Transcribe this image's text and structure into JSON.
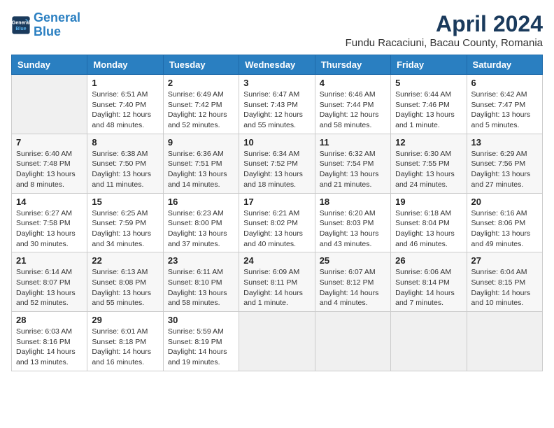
{
  "header": {
    "logo_line1": "General",
    "logo_line2": "Blue",
    "month_title": "April 2024",
    "location": "Fundu Racaciuni, Bacau County, Romania"
  },
  "weekdays": [
    "Sunday",
    "Monday",
    "Tuesday",
    "Wednesday",
    "Thursday",
    "Friday",
    "Saturday"
  ],
  "weeks": [
    [
      {
        "day": "",
        "info": ""
      },
      {
        "day": "1",
        "info": "Sunrise: 6:51 AM\nSunset: 7:40 PM\nDaylight: 12 hours\nand 48 minutes."
      },
      {
        "day": "2",
        "info": "Sunrise: 6:49 AM\nSunset: 7:42 PM\nDaylight: 12 hours\nand 52 minutes."
      },
      {
        "day": "3",
        "info": "Sunrise: 6:47 AM\nSunset: 7:43 PM\nDaylight: 12 hours\nand 55 minutes."
      },
      {
        "day": "4",
        "info": "Sunrise: 6:46 AM\nSunset: 7:44 PM\nDaylight: 12 hours\nand 58 minutes."
      },
      {
        "day": "5",
        "info": "Sunrise: 6:44 AM\nSunset: 7:46 PM\nDaylight: 13 hours\nand 1 minute."
      },
      {
        "day": "6",
        "info": "Sunrise: 6:42 AM\nSunset: 7:47 PM\nDaylight: 13 hours\nand 5 minutes."
      }
    ],
    [
      {
        "day": "7",
        "info": "Sunrise: 6:40 AM\nSunset: 7:48 PM\nDaylight: 13 hours\nand 8 minutes."
      },
      {
        "day": "8",
        "info": "Sunrise: 6:38 AM\nSunset: 7:50 PM\nDaylight: 13 hours\nand 11 minutes."
      },
      {
        "day": "9",
        "info": "Sunrise: 6:36 AM\nSunset: 7:51 PM\nDaylight: 13 hours\nand 14 minutes."
      },
      {
        "day": "10",
        "info": "Sunrise: 6:34 AM\nSunset: 7:52 PM\nDaylight: 13 hours\nand 18 minutes."
      },
      {
        "day": "11",
        "info": "Sunrise: 6:32 AM\nSunset: 7:54 PM\nDaylight: 13 hours\nand 21 minutes."
      },
      {
        "day": "12",
        "info": "Sunrise: 6:30 AM\nSunset: 7:55 PM\nDaylight: 13 hours\nand 24 minutes."
      },
      {
        "day": "13",
        "info": "Sunrise: 6:29 AM\nSunset: 7:56 PM\nDaylight: 13 hours\nand 27 minutes."
      }
    ],
    [
      {
        "day": "14",
        "info": "Sunrise: 6:27 AM\nSunset: 7:58 PM\nDaylight: 13 hours\nand 30 minutes."
      },
      {
        "day": "15",
        "info": "Sunrise: 6:25 AM\nSunset: 7:59 PM\nDaylight: 13 hours\nand 34 minutes."
      },
      {
        "day": "16",
        "info": "Sunrise: 6:23 AM\nSunset: 8:00 PM\nDaylight: 13 hours\nand 37 minutes."
      },
      {
        "day": "17",
        "info": "Sunrise: 6:21 AM\nSunset: 8:02 PM\nDaylight: 13 hours\nand 40 minutes."
      },
      {
        "day": "18",
        "info": "Sunrise: 6:20 AM\nSunset: 8:03 PM\nDaylight: 13 hours\nand 43 minutes."
      },
      {
        "day": "19",
        "info": "Sunrise: 6:18 AM\nSunset: 8:04 PM\nDaylight: 13 hours\nand 46 minutes."
      },
      {
        "day": "20",
        "info": "Sunrise: 6:16 AM\nSunset: 8:06 PM\nDaylight: 13 hours\nand 49 minutes."
      }
    ],
    [
      {
        "day": "21",
        "info": "Sunrise: 6:14 AM\nSunset: 8:07 PM\nDaylight: 13 hours\nand 52 minutes."
      },
      {
        "day": "22",
        "info": "Sunrise: 6:13 AM\nSunset: 8:08 PM\nDaylight: 13 hours\nand 55 minutes."
      },
      {
        "day": "23",
        "info": "Sunrise: 6:11 AM\nSunset: 8:10 PM\nDaylight: 13 hours\nand 58 minutes."
      },
      {
        "day": "24",
        "info": "Sunrise: 6:09 AM\nSunset: 8:11 PM\nDaylight: 14 hours\nand 1 minute."
      },
      {
        "day": "25",
        "info": "Sunrise: 6:07 AM\nSunset: 8:12 PM\nDaylight: 14 hours\nand 4 minutes."
      },
      {
        "day": "26",
        "info": "Sunrise: 6:06 AM\nSunset: 8:14 PM\nDaylight: 14 hours\nand 7 minutes."
      },
      {
        "day": "27",
        "info": "Sunrise: 6:04 AM\nSunset: 8:15 PM\nDaylight: 14 hours\nand 10 minutes."
      }
    ],
    [
      {
        "day": "28",
        "info": "Sunrise: 6:03 AM\nSunset: 8:16 PM\nDaylight: 14 hours\nand 13 minutes."
      },
      {
        "day": "29",
        "info": "Sunrise: 6:01 AM\nSunset: 8:18 PM\nDaylight: 14 hours\nand 16 minutes."
      },
      {
        "day": "30",
        "info": "Sunrise: 5:59 AM\nSunset: 8:19 PM\nDaylight: 14 hours\nand 19 minutes."
      },
      {
        "day": "",
        "info": ""
      },
      {
        "day": "",
        "info": ""
      },
      {
        "day": "",
        "info": ""
      },
      {
        "day": "",
        "info": ""
      }
    ]
  ]
}
